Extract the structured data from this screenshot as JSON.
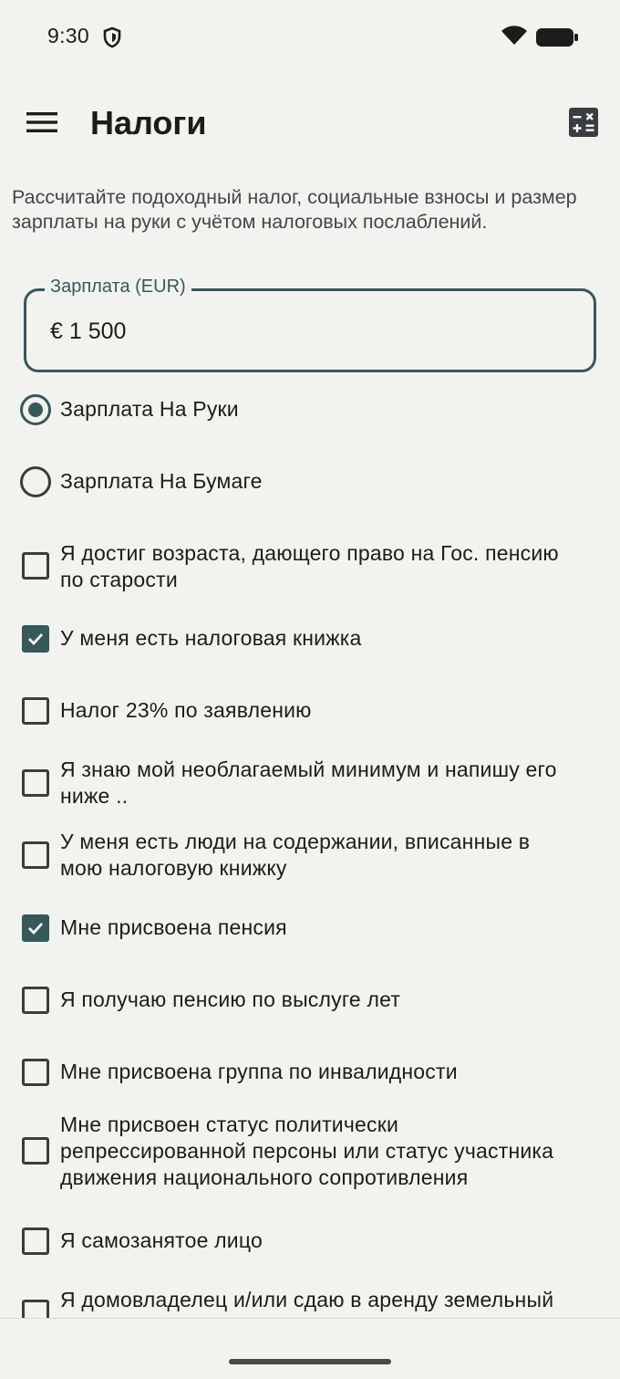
{
  "status_bar": {
    "time": "9:30"
  },
  "app_bar": {
    "title": "Налоги"
  },
  "description": "Рассчитайте подоходный налог, социальные взносы и размер зарплаты на руки с учётом налоговых послаблений.",
  "salary_field": {
    "label": "Зарплата (EUR)",
    "value": "€ 1 500"
  },
  "salary_type": [
    {
      "label": "Зарплата На Руки",
      "selected": true
    },
    {
      "label": "Зарплата На Бумаге",
      "selected": false
    }
  ],
  "options": [
    {
      "line1": "Я достиг возраста, дающего право на Гос. пенсию",
      "line2": "по старости",
      "line3": "",
      "checked": false
    },
    {
      "line1": "У меня есть налоговая книжка",
      "line2": "",
      "line3": "",
      "checked": true
    },
    {
      "line1": "Налог 23% по заявлению",
      "line2": "",
      "line3": "",
      "checked": false
    },
    {
      "line1": "Я знаю мой необлагаемый минимум и напишу его",
      "line2": "ниже ..",
      "line3": "",
      "checked": false
    },
    {
      "line1": "У меня есть люди на содержании, вписанные в",
      "line2": "мою налоговую книжку",
      "line3": "",
      "checked": false
    },
    {
      "line1": "Мне присвоена пенсия",
      "line2": "",
      "line3": "",
      "checked": true
    },
    {
      "line1": "Я получаю пенсию по выслуге лет",
      "line2": "",
      "line3": "",
      "checked": false
    },
    {
      "line1": "Мне присвоена группа по инвалидности",
      "line2": "",
      "line3": "",
      "checked": false
    },
    {
      "line1": "Мне присвоен статус политически",
      "line2": "репрессированной персоны или статус участника",
      "line3": "движения национального сопротивления",
      "checked": false
    },
    {
      "line1": "Я самозанятое лицо",
      "line2": "",
      "line3": "",
      "checked": false
    },
    {
      "line1": "Я домовладелец и/или сдаю в аренду земельный",
      "line2": "",
      "line3": "",
      "checked": false
    }
  ],
  "colors": {
    "accent": "#36595a",
    "background": "#f2f2ef",
    "text": "#1c1c1a"
  },
  "icons": {
    "menu": "hamburger-menu-icon",
    "calculator": "calculator-icon",
    "status": [
      "shield-icon",
      "wifi-icon",
      "battery-icon"
    ]
  }
}
